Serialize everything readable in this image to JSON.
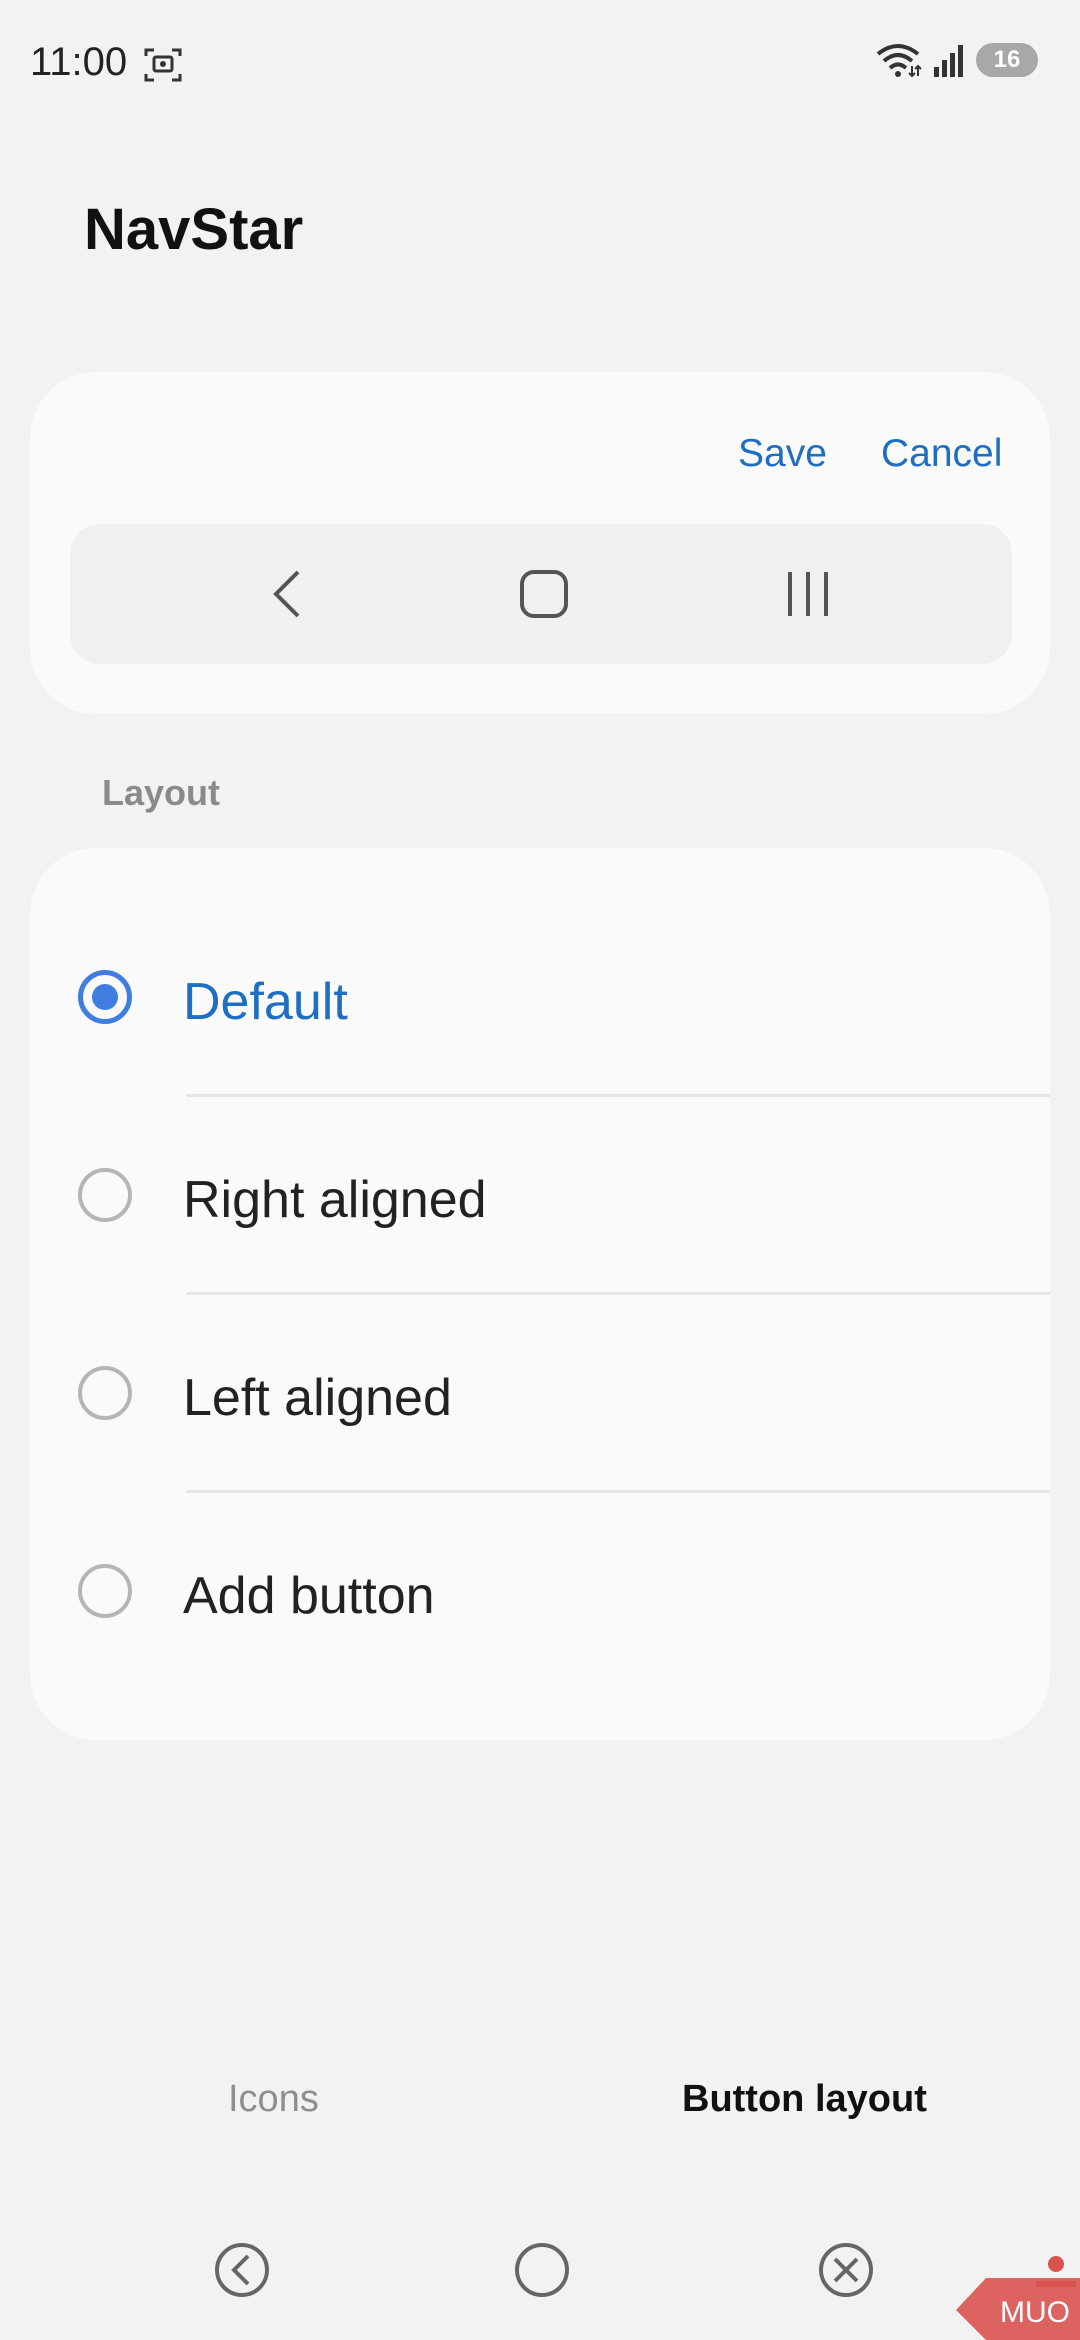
{
  "status_bar": {
    "time": "11:00",
    "battery": "16"
  },
  "page": {
    "title": "NavStar"
  },
  "preview": {
    "save_label": "Save",
    "cancel_label": "Cancel",
    "buttons": [
      "back-chevron-icon",
      "home-square-icon",
      "recents-bars-icon"
    ]
  },
  "layout": {
    "section_label": "Layout",
    "options": [
      {
        "label": "Default",
        "selected": true
      },
      {
        "label": "Right aligned",
        "selected": false
      },
      {
        "label": "Left aligned",
        "selected": false
      },
      {
        "label": "Add button",
        "selected": false
      }
    ]
  },
  "tabs": {
    "icons_label": "Icons",
    "button_layout_label": "Button layout",
    "active": "Button layout"
  },
  "system_nav": [
    "back-icon",
    "home-icon",
    "close-icon"
  ],
  "watermark": {
    "text": "MUO"
  },
  "colors": {
    "accent": "#1e6fc4",
    "radio_accent": "#3f7de0",
    "background": "#f2f2f2",
    "card": "#fafafa"
  }
}
